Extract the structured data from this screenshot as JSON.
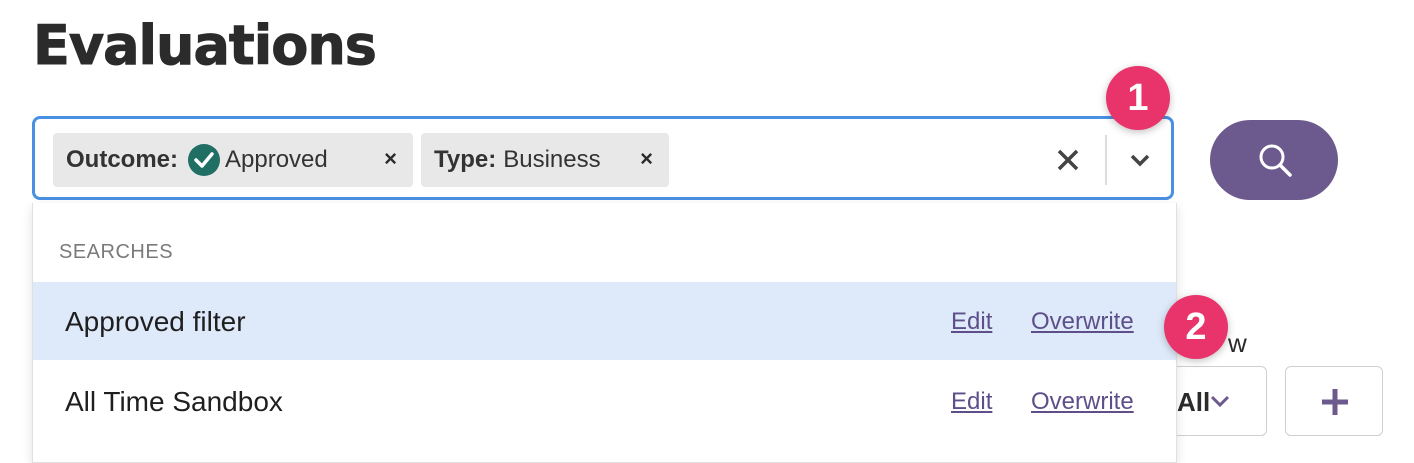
{
  "page": {
    "title": "Evaluations"
  },
  "search": {
    "chips": [
      {
        "key": "Outcome:",
        "value": "Approved",
        "icon": "check-circle-icon",
        "remove": "×"
      },
      {
        "key": "Type:",
        "value": "Business",
        "remove": "×"
      }
    ]
  },
  "dropdown": {
    "section_header": "SEARCHES",
    "items": [
      {
        "name": "Approved filter",
        "edit": "Edit",
        "overwrite": "Overwrite",
        "selected": true
      },
      {
        "name": "All Time Sandbox",
        "edit": "Edit",
        "overwrite": "Overwrite",
        "selected": false
      }
    ]
  },
  "markers": [
    "1",
    "2"
  ],
  "background": {
    "partial_text": "w",
    "all_button": "All",
    "plus_icon": "plus-icon"
  },
  "colors": {
    "accent": "#6c5a8e",
    "focus_border": "#4a90e2",
    "marker": "#e8336b",
    "selected_row": "#deeafa",
    "check": "#1f6f64"
  }
}
